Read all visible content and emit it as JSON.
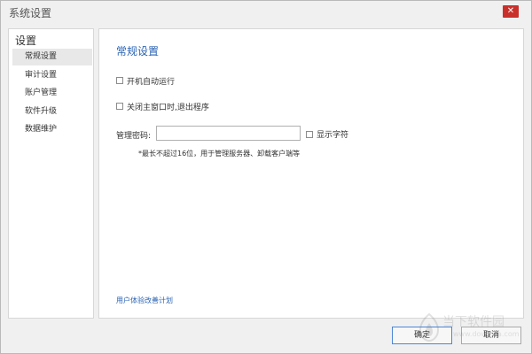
{
  "window": {
    "title": "系统设置",
    "close_glyph": "✕"
  },
  "sidebar": {
    "heading": "设置",
    "items": [
      {
        "label": "常规设置",
        "active": true
      },
      {
        "label": "审计设置",
        "active": false
      },
      {
        "label": "账户管理",
        "active": false
      },
      {
        "label": "软件升级",
        "active": false
      },
      {
        "label": "数据维护",
        "active": false
      }
    ]
  },
  "main": {
    "section_title": "常规设置",
    "auto_start_label": "开机自动运行",
    "exit_on_close_label": "关闭主窗口时,退出程序",
    "password_label": "管理密码:",
    "password_value": "",
    "show_chars_label": "显示字符",
    "hint": "*最长不超过16位，用于管理服务器、卸载客户端等",
    "ux_plan_link": "用户体验改善计划"
  },
  "footer": {
    "ok_label": "确定",
    "cancel_label": "取消"
  },
  "watermark": {
    "text": "当下软件园",
    "sub": "www.downxia.com"
  },
  "colors": {
    "accent_blue": "#2a63b3",
    "close_red": "#c9302c"
  }
}
